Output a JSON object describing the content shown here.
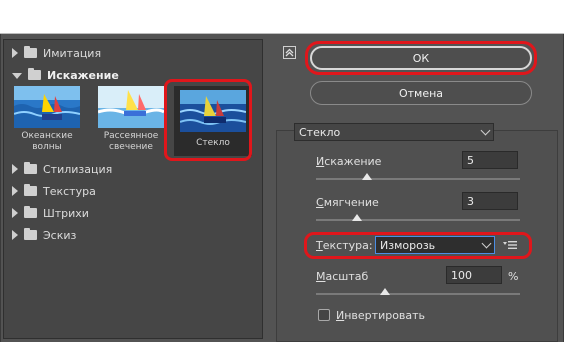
{
  "categories": [
    {
      "label": "Имитация",
      "expanded": false
    },
    {
      "label": "Искажение",
      "expanded": true
    },
    {
      "label": "Стилизация",
      "expanded": false
    },
    {
      "label": "Текстура",
      "expanded": false
    },
    {
      "label": "Штрихи",
      "expanded": false
    },
    {
      "label": "Эскиз",
      "expanded": false
    }
  ],
  "thumbnails": [
    {
      "caption_line1": "Океанские волны",
      "caption_line2": ""
    },
    {
      "caption_line1": "Рассеянное",
      "caption_line2": "свечение"
    },
    {
      "caption_line1": "Стекло",
      "caption_line2": "",
      "selected": true
    }
  ],
  "buttons": {
    "ok": "ОК",
    "cancel": "Отмена"
  },
  "filter_select": {
    "value": "Стекло"
  },
  "params": {
    "distortion": {
      "prefix": "",
      "ul": "И",
      "rest": "скажение",
      "value": "5",
      "level": 0.25
    },
    "smoothness": {
      "prefix": "",
      "ul": "С",
      "rest": "мягчение",
      "value": "3",
      "level": 0.2
    },
    "texture": {
      "prefix": "",
      "ul": "Т",
      "rest": "екстура:",
      "value": "Изморозь"
    },
    "scale": {
      "prefix": "",
      "ul": "М",
      "rest": "асштаб",
      "value": "100",
      "unit": "%",
      "level": 0.34
    },
    "invert": {
      "prefix": "",
      "ul": "И",
      "rest": "нвертировать",
      "checked": false
    }
  },
  "colors": {
    "highlight": "#e0161b",
    "panel": "#535353"
  }
}
